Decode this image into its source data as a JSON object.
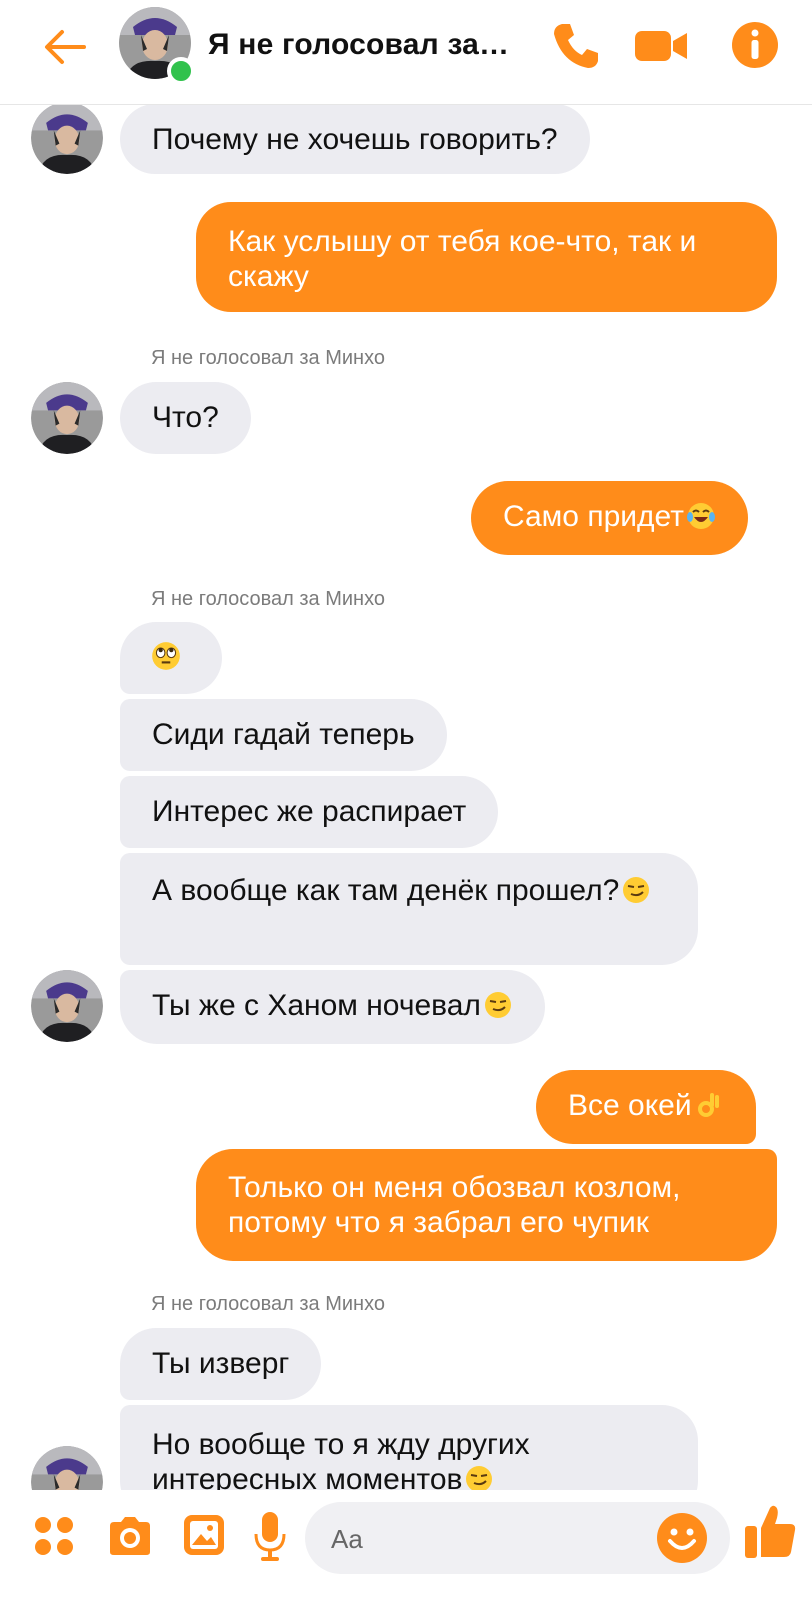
{
  "header": {
    "title": "Я не голосовал за…",
    "icons": {
      "back": "back-arrow-icon",
      "phone": "phone-icon",
      "video": "video-camera-icon",
      "info": "info-icon"
    }
  },
  "colors": {
    "accent": "#ff8c1a",
    "incoming": "#ececf1",
    "online": "#31c24d"
  },
  "messages": {
    "m1": "Почему не хочешь говорить?",
    "m2": "Как услышу от тебя кое-что, так и скажу",
    "sender1": "Я не голосовал за Минхо",
    "m3": "Что?",
    "m4": "Само придет",
    "sender2": "Я не голосовал за Минхо",
    "m6": "Сиди гадай теперь",
    "m7": "Интерес же распирает",
    "m8": "А вообще как там денёк прошел?",
    "m9": "Ты же с Ханом ночевал",
    "m10": "Все окей",
    "m11": "Только он меня обозвал козлом, потому что я забрал его чупик",
    "sender3": "Я не голосовал за Минхо",
    "m12": "Ты изверг",
    "m13": "Но вообще то я жду других интересных моментов"
  },
  "composer": {
    "placeholder": "Aa",
    "icons": [
      "menu-dots-icon",
      "camera-icon",
      "gallery-icon",
      "microphone-icon",
      "emoji-icon",
      "thumbs-up-icon"
    ]
  }
}
